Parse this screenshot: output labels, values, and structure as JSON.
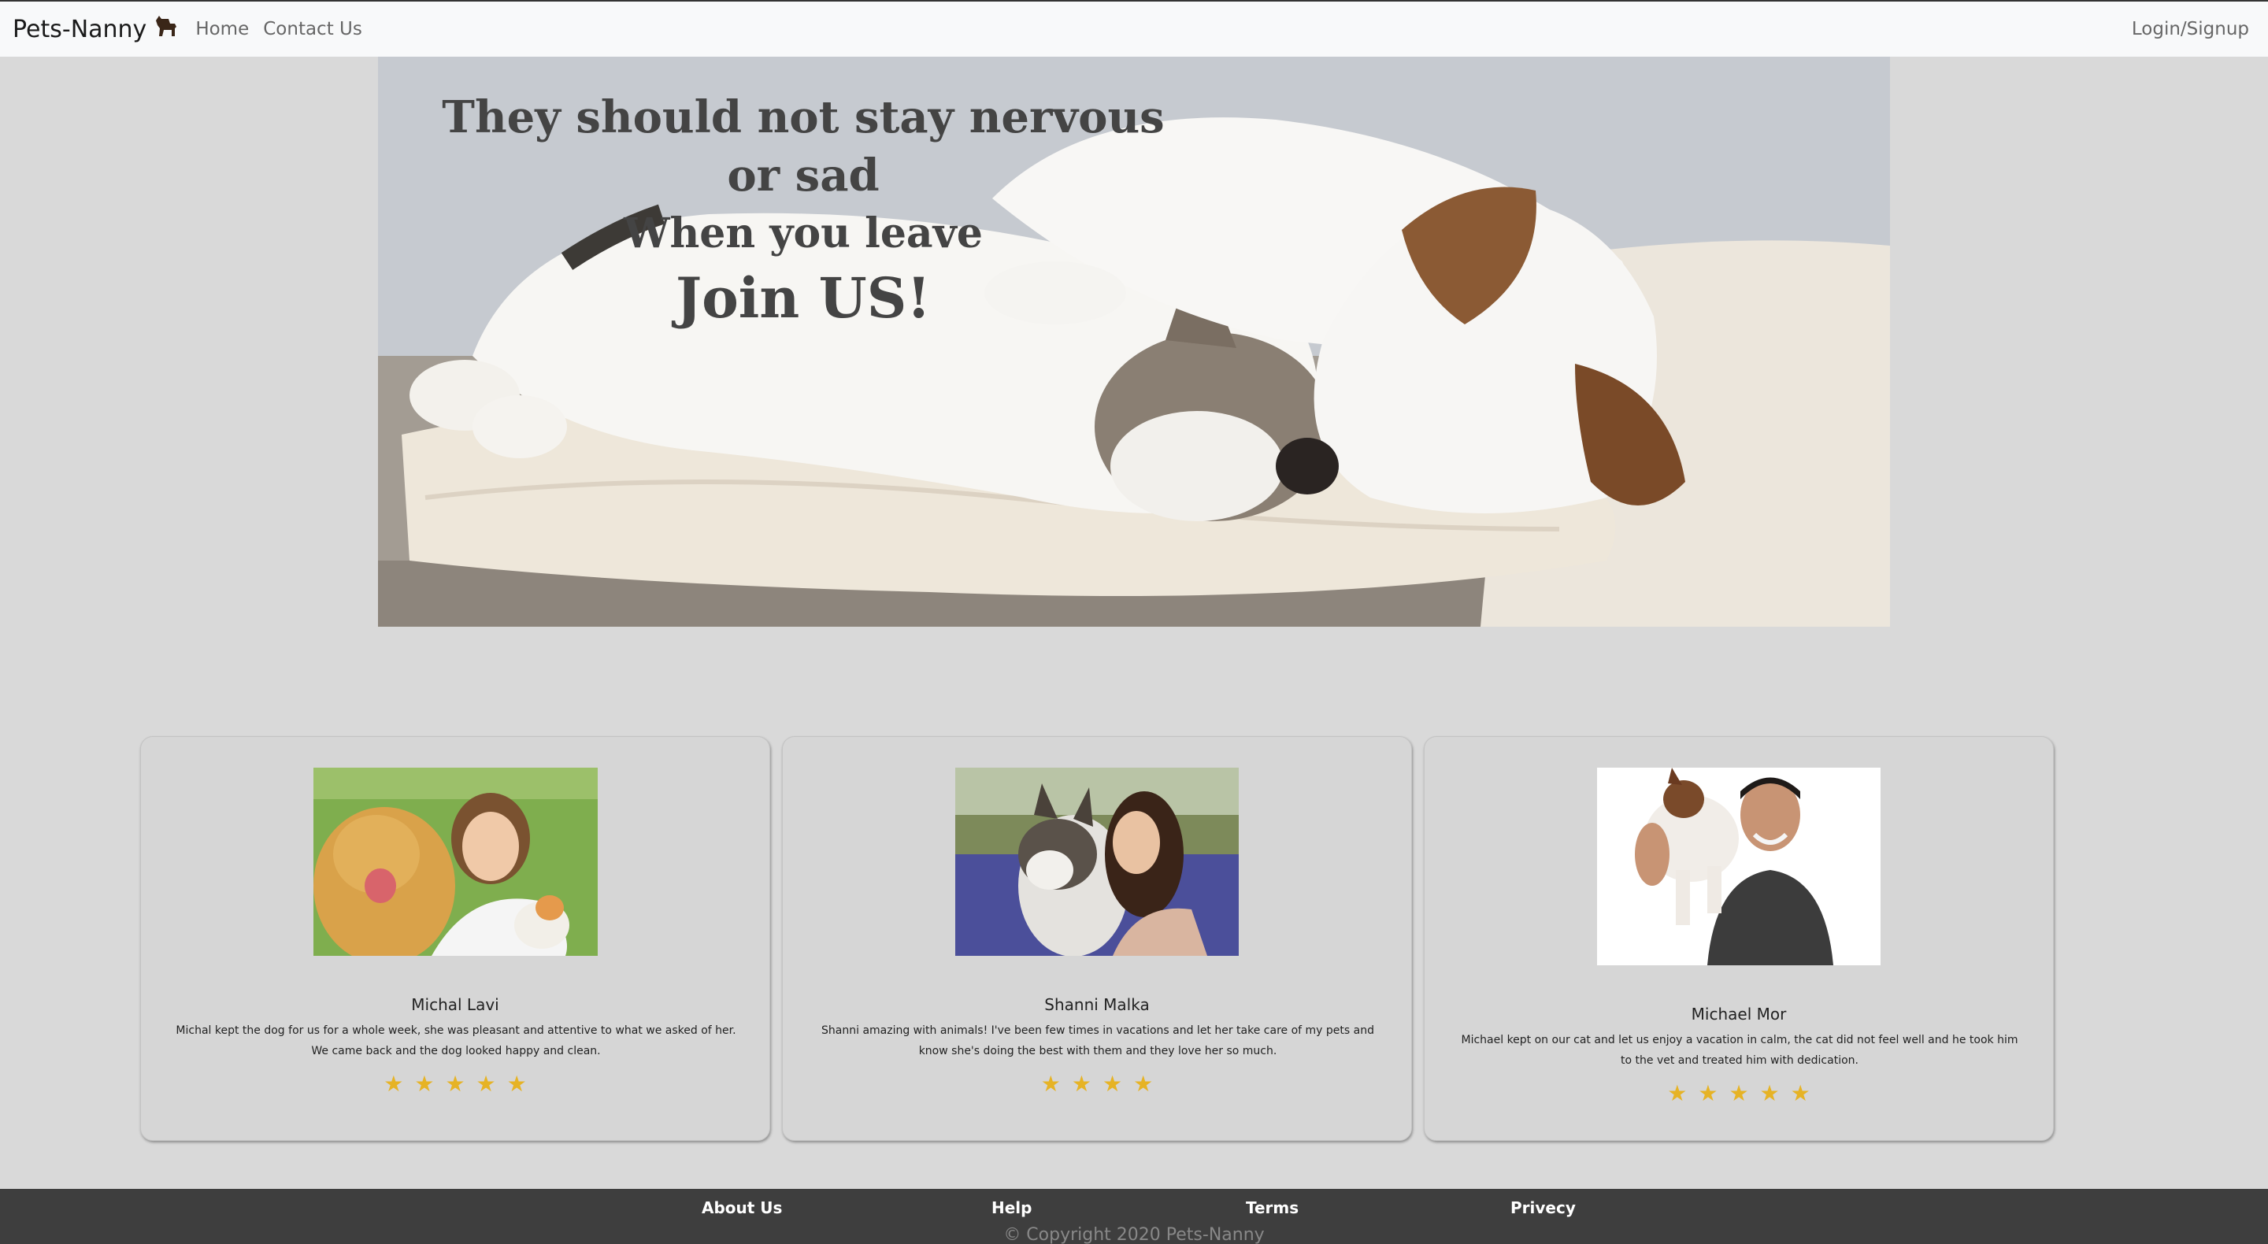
{
  "nav": {
    "brand": "Pets-Nanny",
    "brand_icon": "dog-icon",
    "links": [
      "Home",
      "Contact Us"
    ],
    "login": "Login/Signup"
  },
  "hero": {
    "line1": "They should not stay nervous or sad",
    "line2": "When you leave",
    "line3": "Join US!"
  },
  "reviews": [
    {
      "name": "Michal Lavi",
      "text": "Michal kept the dog for us for a whole week, she was pleasant and attentive to what we asked of her. We came back and the dog looked happy and clean.",
      "stars": "★ ★ ★ ★ ★",
      "rating": 5
    },
    {
      "name": "Shanni Malka",
      "text": "Shanni amazing with animals! I've been few times in vacations and let her take care of my pets and know she's doing the best with them and they love her so much.",
      "stars": "★ ★ ★ ★",
      "rating": 4
    },
    {
      "name": "Michael Mor",
      "text": "Michael kept on our cat and let us enjoy a vacation in calm, the cat did not feel well and he took him to the vet and treated him with dedication.",
      "stars": "★ ★ ★ ★ ★",
      "rating": 5
    }
  ],
  "footer": {
    "links": [
      "About Us",
      "Help",
      "Terms",
      "Privecy"
    ],
    "copyright": "© Copyright 2020 Pets-Nanny"
  },
  "colors": {
    "navbar_bg": "#f8f9fa",
    "page_bg": "#d9d9d9",
    "footer_bg": "#3e3e3e",
    "star": "#e6b325"
  }
}
